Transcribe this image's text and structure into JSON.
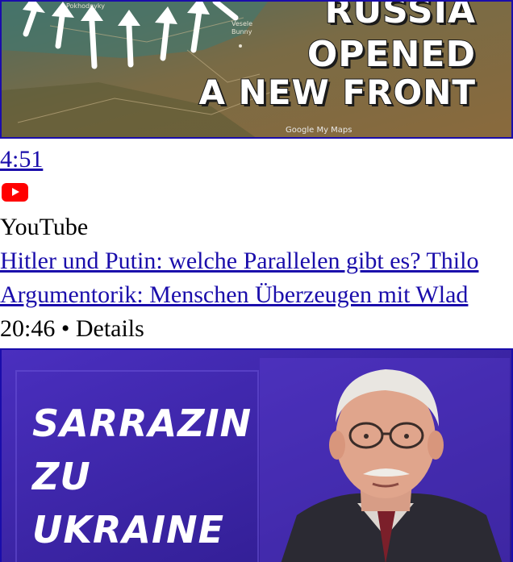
{
  "result1": {
    "thumbnail": {
      "headline": [
        "RUSSIA",
        "OPENED",
        "A NEW FRONT"
      ],
      "map_credit": "Google My Maps"
    },
    "duration": "4:51",
    "source_icon": "youtube-play-icon",
    "source_name": "YouTube"
  },
  "result2": {
    "title_line1": "Hitler und Putin: welche Parallelen gibt es? Thilo",
    "title_line2": "Argumentorik: Menschen Überzeugen mit Wlad",
    "meta": "20:46 • Details",
    "thumbnail": {
      "headline": [
        "SARRAZIN",
        "ZU",
        "UKRAINE"
      ]
    }
  },
  "colors": {
    "link": "#1a0dab",
    "youtube_red": "#ff0000",
    "thumb2_bg": "#3f24a8"
  }
}
